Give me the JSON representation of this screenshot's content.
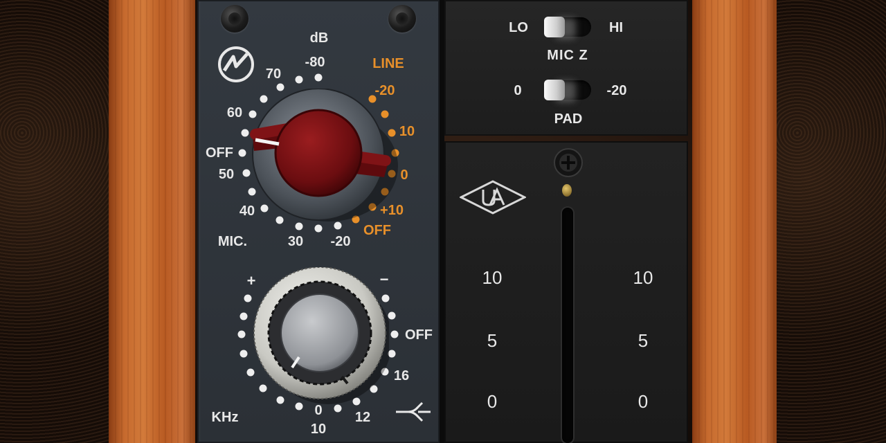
{
  "preamp": {
    "db_label": "dB",
    "line_label": "LINE",
    "mic_label": "MIC.",
    "gain_scale_white": [
      "-80",
      "70",
      "60",
      "OFF",
      "50",
      "40",
      "30",
      "-20"
    ],
    "gain_scale_orange": [
      "-20",
      "10",
      "0",
      "+10",
      "OFF"
    ],
    "knob_color": "#7a0f12"
  },
  "eq": {
    "plus_label": "+",
    "minus_label": "−",
    "khz_label": "KHz",
    "off_label": "OFF",
    "freq_16": "16",
    "freq_12": "12",
    "freq_0": "0",
    "freq_10": "10"
  },
  "mic_z": {
    "lo_label": "LO",
    "hi_label": "HI",
    "title": "MIC  Z",
    "selected": "LO"
  },
  "pad": {
    "zero_label": "0",
    "minus20_label": "-20",
    "title": "PAD",
    "selected": "0"
  },
  "meter": {
    "left_ticks": [
      "10",
      "5",
      "0"
    ],
    "right_ticks": [
      "10",
      "5",
      "0"
    ]
  },
  "icons": {
    "brand": "neve-logo-icon",
    "maker": "ua-logo-icon",
    "highpass": "high-pass-filter-icon"
  },
  "colors": {
    "accent_orange": "#e8902a",
    "panel": "#30353b",
    "wood": "#c66a2e"
  }
}
